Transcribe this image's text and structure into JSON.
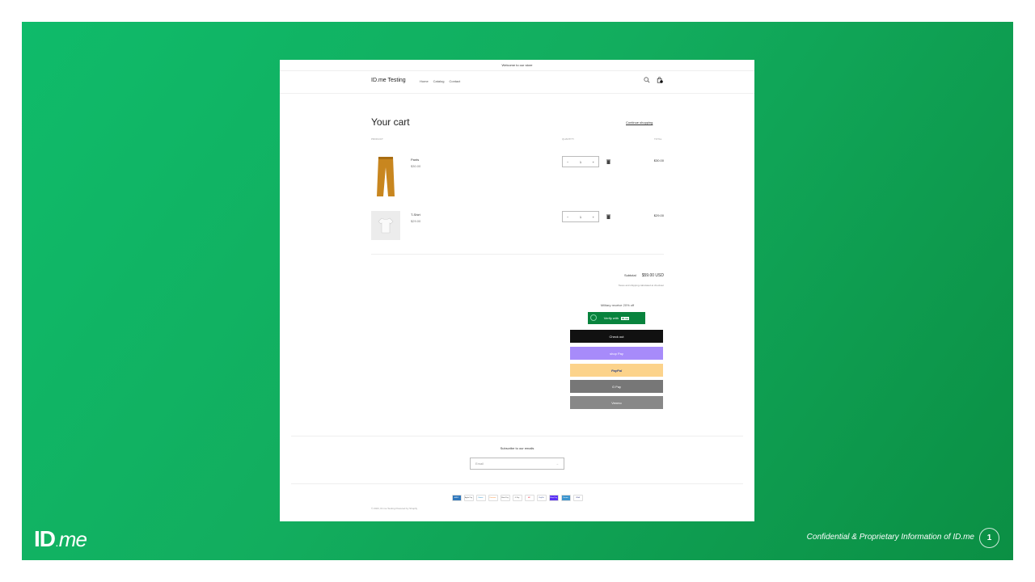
{
  "store": {
    "announcement": "Welcome to our store",
    "brand": "ID.me Testing",
    "nav": [
      "Home",
      "Catalog",
      "Contact"
    ]
  },
  "cart": {
    "title": "Your cart",
    "continue_link": "Continue shopping",
    "col_product": "PRODUCT",
    "col_quantity": "QUANTITY",
    "col_total": "TOTAL",
    "items": [
      {
        "name": "Pants",
        "price": "$30.00",
        "quantity": "1",
        "total": "$30.00",
        "color": "#c8861f"
      },
      {
        "name": "T-Shirt",
        "price": "$29.00",
        "quantity": "1",
        "total": "$29.00",
        "color": "#e6e6e6"
      }
    ],
    "subtotal_label": "Subtotal",
    "subtotal_value": "$59.00 USD",
    "tax_note": "Taxes and shipping calculated at checkout",
    "military_text": "Military receive 20% off",
    "verify_label": "Verify with",
    "verify_logo": "ID.me",
    "checkout_label": "Check out",
    "shoppay_label": "shop Pay",
    "paypal_label": "PayPal",
    "gpay_label": "G Pay",
    "venmo_label": "Venmo"
  },
  "footer": {
    "subscribe_title": "Subscribe to our emails",
    "email_placeholder": "Email",
    "payment_icons": [
      "AMEX",
      "Apple Pay",
      "Diners",
      "Discover",
      "Meta Pay",
      "G Pay",
      "MC",
      "PayPal",
      "Shop Pay",
      "Venmo",
      "VISA"
    ],
    "copyright": "© 2023, ID.me Testing Powered by Shopify"
  },
  "slide": {
    "logo_id": "ID",
    "logo_me": "me",
    "confidential": "Confidential & Proprietary Information of ID.me",
    "page_number": "1"
  },
  "colors": {
    "brand_green": "#08833d",
    "slide_green": "#12ad5e",
    "shoppay_purple": "#a78bfa",
    "paypal_yellow": "#fcd38b"
  }
}
